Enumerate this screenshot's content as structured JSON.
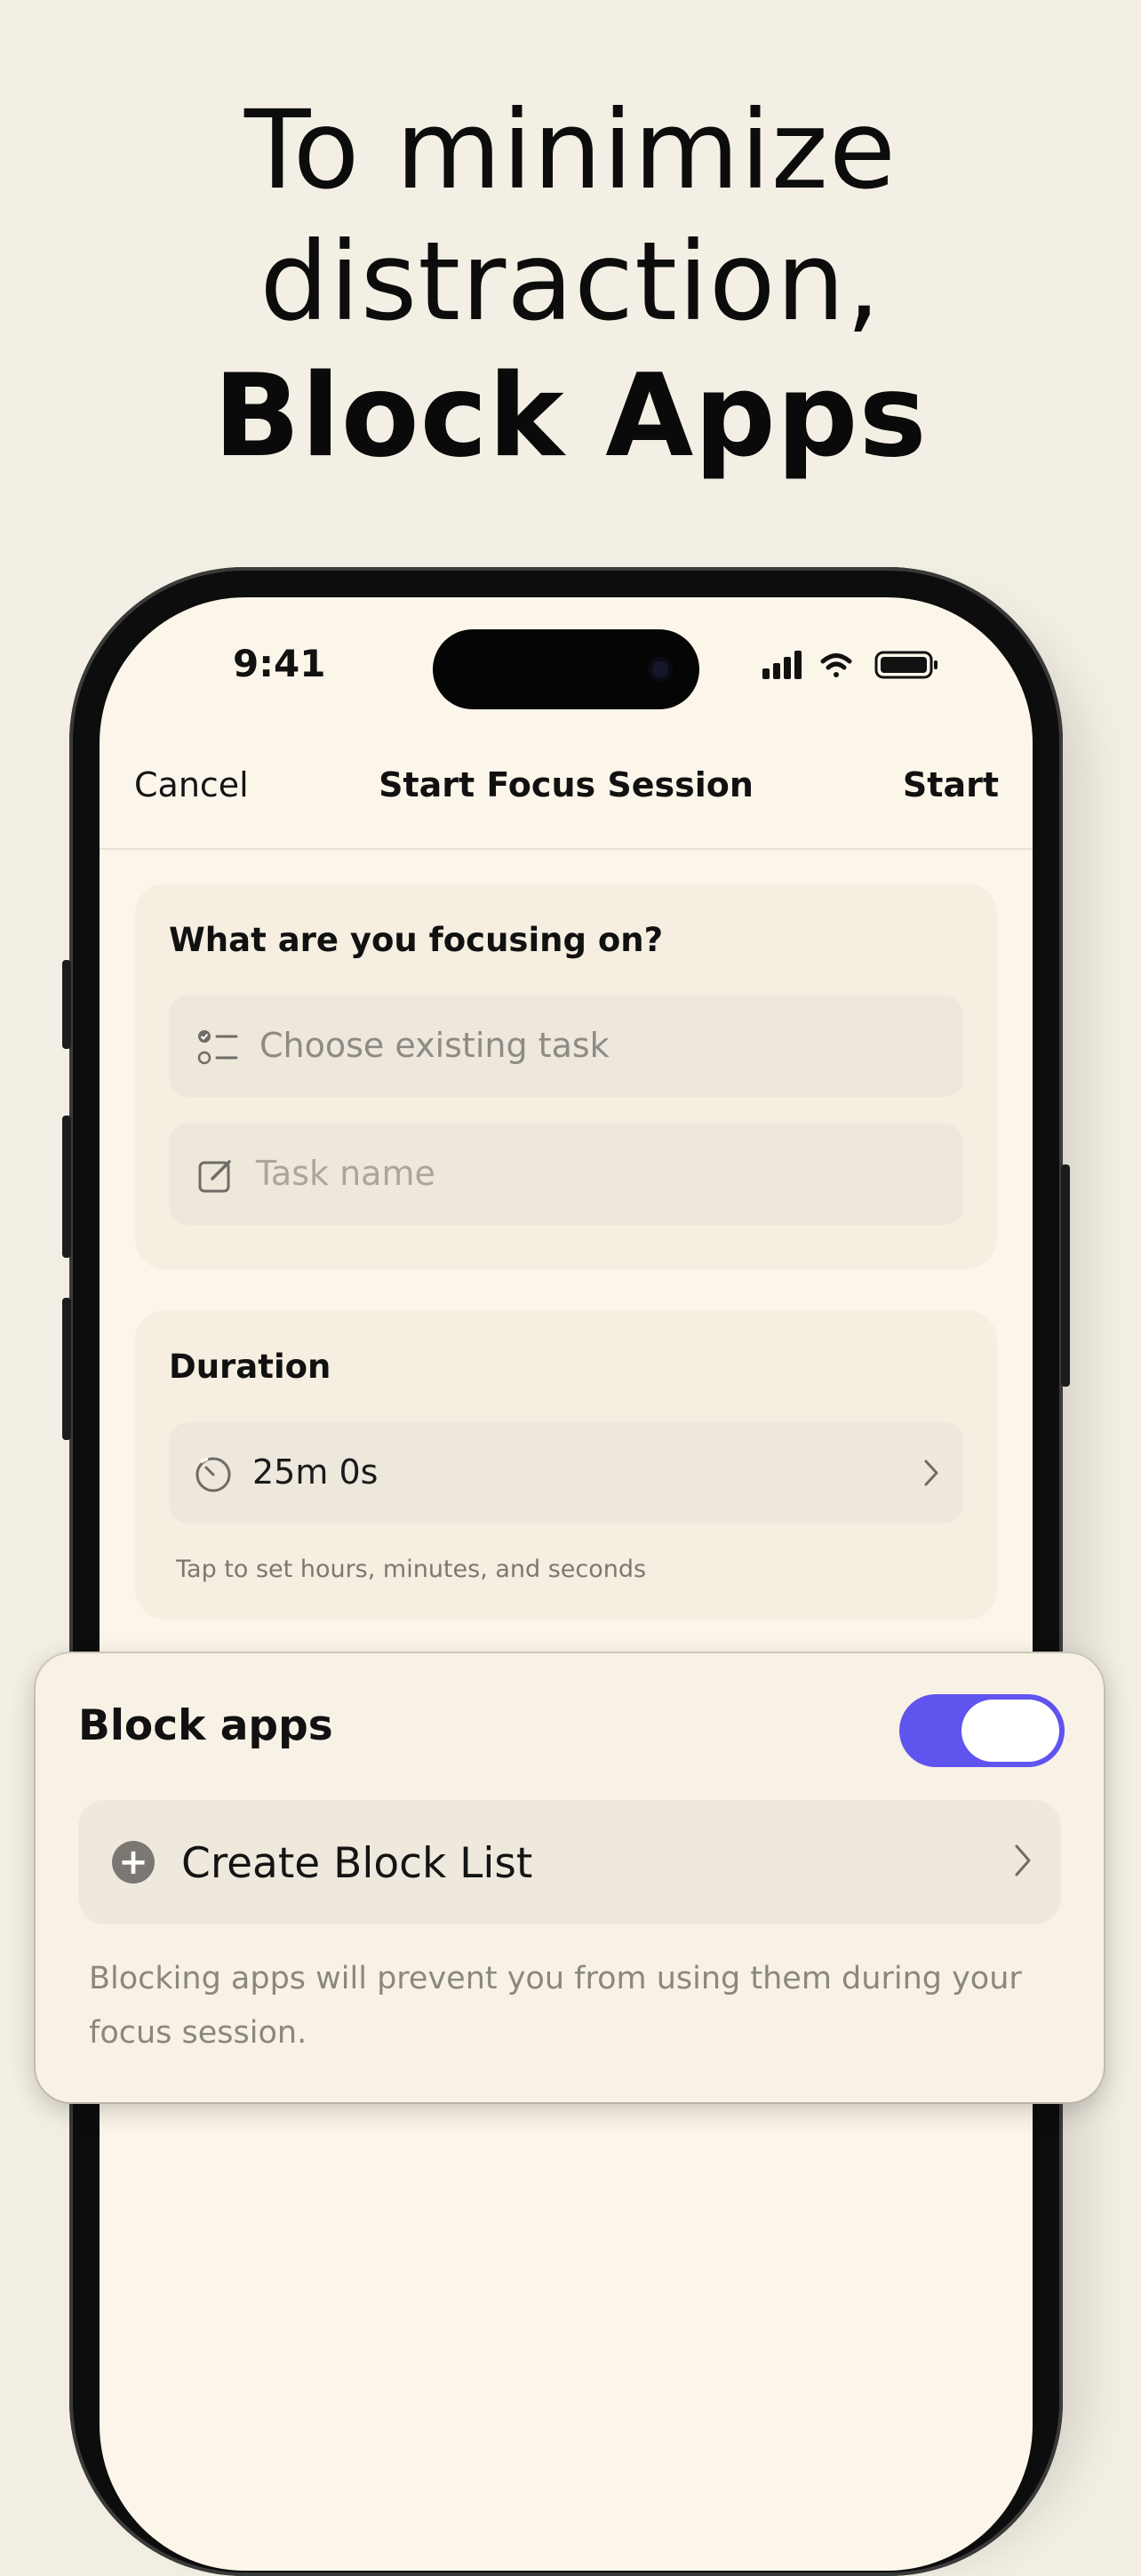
{
  "headline": {
    "line1": "To minimize",
    "line2": "distraction,",
    "line3": "Block Apps"
  },
  "status_bar": {
    "time": "9:41",
    "icons": [
      "signal-icon",
      "wifi-icon",
      "battery-icon"
    ]
  },
  "nav": {
    "cancel_label": "Cancel",
    "title": "Start Focus Session",
    "start_label": "Start"
  },
  "focus_card": {
    "label": "What are you focusing on?",
    "choose_task_placeholder": "Choose existing task",
    "task_name_placeholder": "Task name"
  },
  "duration_card": {
    "label": "Duration",
    "value": "25m 0s",
    "hint": "Tap to set hours, minutes, and seconds"
  },
  "block_apps": {
    "label": "Block apps",
    "toggle_on": true,
    "create_list_label": "Create Block List",
    "description": "Blocking apps will prevent you from using them during your focus session."
  },
  "colors": {
    "background": "#f3efe4",
    "screen": "#fcf6ea",
    "card": "#f5eee1",
    "toggle_accent": "#6054ef"
  }
}
